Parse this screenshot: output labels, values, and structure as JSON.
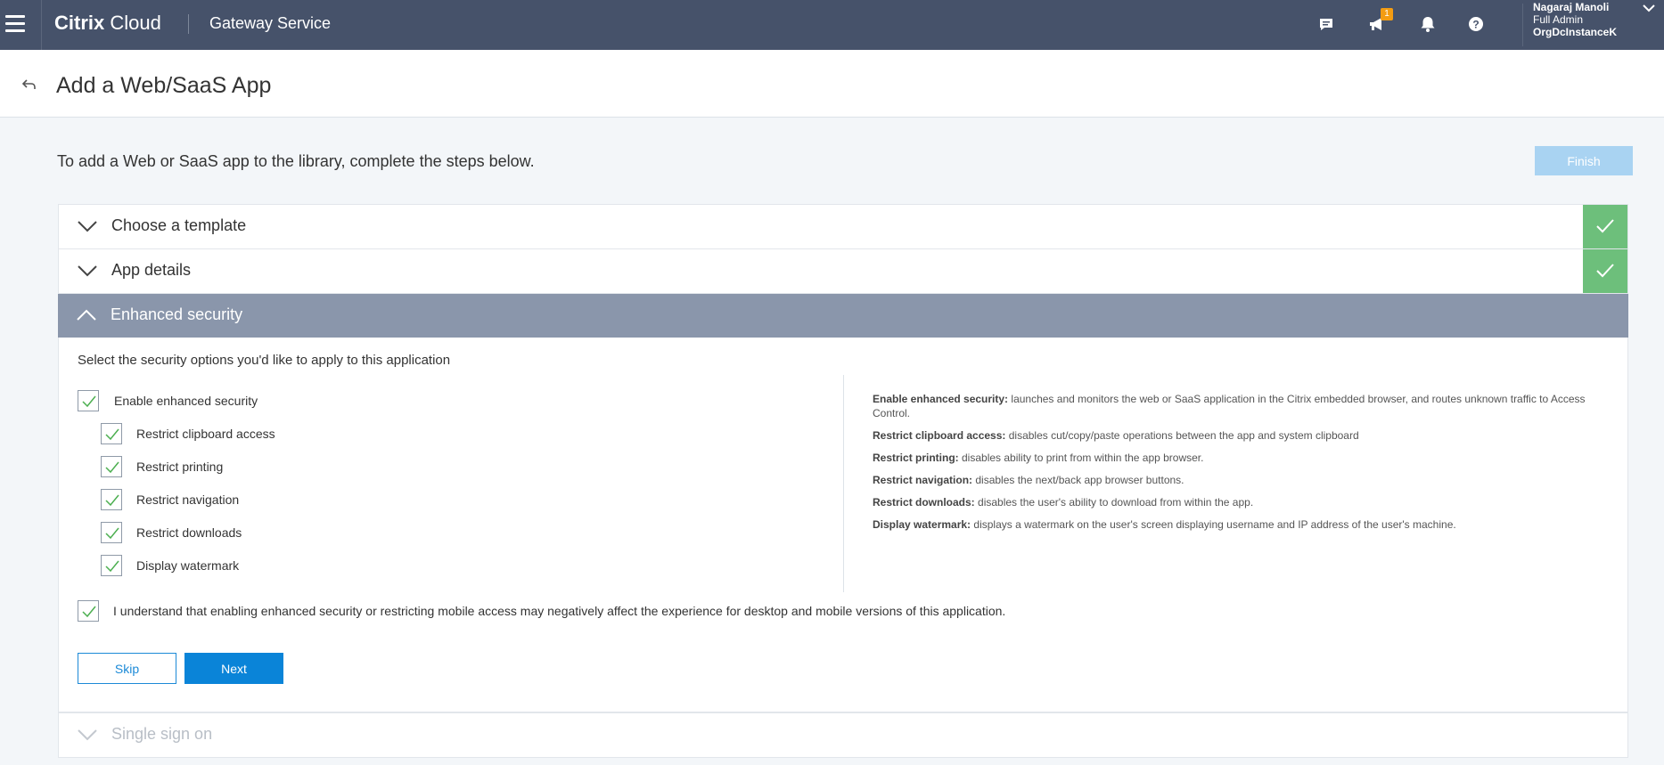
{
  "app": {
    "brand_bold": "Citrix",
    "brand_light": "Cloud",
    "service": "Gateway Service",
    "notification_count": "1",
    "user_name": "Nagaraj Manoli",
    "user_line2": "Full Admin",
    "user_line3": "OrgDcInstanceK"
  },
  "page": {
    "title": "Add a Web/SaaS App",
    "intro": "To add a Web or SaaS app to the library, complete the steps below.",
    "finish_label": "Finish"
  },
  "steps": [
    {
      "title": "Choose a template",
      "status": "complete"
    },
    {
      "title": "App details",
      "status": "complete"
    },
    {
      "title": "Enhanced security",
      "status": "active"
    },
    {
      "title": "Single sign on",
      "status": "disabled"
    }
  ],
  "security": {
    "lead": "Select the security options you'd like to apply to this application",
    "enable_label": "Enable enhanced security",
    "options": [
      {
        "label": "Restrict clipboard access",
        "checked": true
      },
      {
        "label": "Restrict printing",
        "checked": true
      },
      {
        "label": "Restrict navigation",
        "checked": true
      },
      {
        "label": "Restrict downloads",
        "checked": true
      },
      {
        "label": "Display watermark",
        "checked": true
      }
    ],
    "descriptions": [
      {
        "term": "Enable enhanced security:",
        "text": " launches and monitors the web or SaaS application in the Citrix embedded browser, and routes unknown traffic to Access Control."
      },
      {
        "term": "Restrict clipboard access:",
        "text": " disables cut/copy/paste operations between the app and system clipboard"
      },
      {
        "term": "Restrict printing:",
        "text": " disables ability to print from within the app browser."
      },
      {
        "term": "Restrict navigation:",
        "text": " disables the next/back app browser buttons."
      },
      {
        "term": "Restrict downloads:",
        "text": " disables the user's ability to download from within the app."
      },
      {
        "term": "Display watermark:",
        "text": " displays a watermark on the user's screen displaying username and IP address of the user's machine."
      }
    ],
    "acknowledge_label": "I understand that enabling enhanced security or restricting mobile access may negatively affect the experience for desktop and mobile versions of this application.",
    "skip_label": "Skip",
    "next_label": "Next"
  },
  "colors": {
    "topbar": "#46526a",
    "complete_green": "#6dbf7b",
    "active_step": "#8a96ab",
    "primary": "#0a84d8",
    "finish_disabled": "#a9d3f2"
  }
}
